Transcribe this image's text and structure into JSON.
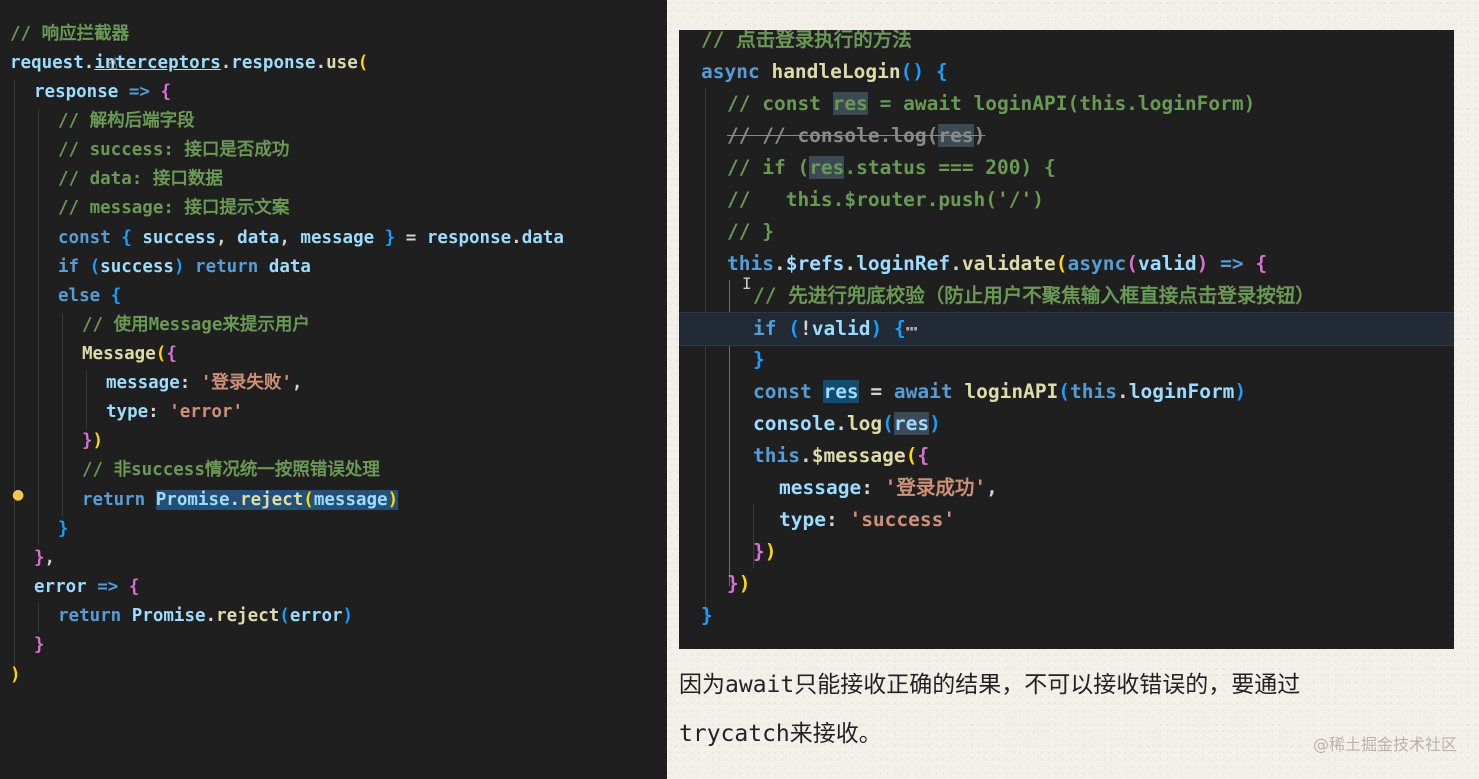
{
  "left_editor": {
    "code": {
      "line_01": [
        "// 响应拦截器"
      ],
      "line_02": [
        "request",
        ".",
        "interceptors",
        ".",
        "response",
        ".",
        "use",
        "("
      ],
      "line_03": [
        "response",
        " ",
        "=>",
        " ",
        "{"
      ],
      "line_04": [
        "// 解构后端字段"
      ],
      "line_05": [
        "// success: 接口是否成功"
      ],
      "line_06": [
        "// data: 接口数据"
      ],
      "line_07": [
        "// message: 接口提示文案"
      ],
      "line_08": [
        "const",
        " ",
        "{",
        " ",
        "success",
        ", ",
        "data",
        ", ",
        "message",
        " ",
        "}",
        " = ",
        "response",
        ".",
        "data"
      ],
      "line_09": [
        "if",
        " ",
        "(",
        "success",
        ")",
        " ",
        "return",
        " ",
        "data"
      ],
      "line_10": [
        "else",
        " ",
        "{"
      ],
      "line_11": [
        "// 使用Message来提示用户"
      ],
      "line_12": [
        "Message",
        "(",
        "{"
      ],
      "line_13": [
        "message",
        ": ",
        "'登录失败'",
        ","
      ],
      "line_14": [
        "type",
        ": ",
        "'error'"
      ],
      "line_15": [
        "}",
        ")"
      ],
      "line_16": [
        "// 非success情况统一按照错误处理"
      ],
      "line_17": [
        "return",
        " ",
        "Promise",
        ".",
        "reject",
        "(",
        "message",
        ")"
      ],
      "line_18": [
        "}"
      ],
      "line_19": [
        "}",
        ","
      ],
      "line_20": [
        "error",
        " ",
        "=>",
        " ",
        "{"
      ],
      "line_21": [
        "return",
        " ",
        "Promise",
        ".",
        "reject",
        "(",
        "error",
        ")"
      ],
      "line_22": [
        "}"
      ],
      "line_23": [
        ")"
      ]
    },
    "gutter_icon": "lightbulb-icon",
    "mouse_icon": "hand-pointer-icon"
  },
  "right_editor": {
    "code": {
      "line_01": [
        "// 点击登录执行的方法"
      ],
      "line_02": [
        "async",
        " ",
        "handleLogin",
        "(",
        ")",
        " ",
        "{"
      ],
      "line_03": [
        "// const ",
        "res",
        " = await loginAPI(this.loginForm)"
      ],
      "line_04": [
        "// // console.log(",
        "res",
        ")"
      ],
      "line_05": [
        "// if (",
        "res",
        ".status === 200) {"
      ],
      "line_06": [
        "//   this.$router.push('/')"
      ],
      "line_07": [
        "// }"
      ],
      "line_08": [
        "this",
        ".",
        "$refs",
        ".",
        "loginRef",
        ".",
        "validate",
        "(",
        "async",
        "(",
        "valid",
        ")",
        " ",
        "=>",
        " ",
        "{"
      ],
      "line_09": [
        "// 先进行兜底校验（防止用户不聚焦输入框直接点击登录按钮）"
      ],
      "line_10": [
        "if",
        " ",
        "(",
        "!",
        "valid",
        ")",
        " ",
        "{",
        "⋯"
      ],
      "line_11": [
        "}"
      ],
      "line_12": [
        "const",
        " ",
        "res",
        " = ",
        "await",
        " ",
        "loginAPI",
        "(",
        "this",
        ".",
        "loginForm",
        ")"
      ],
      "line_13": [
        "console",
        ".",
        "log",
        "(",
        "res",
        ")"
      ],
      "line_14": [
        "this",
        ".",
        "$message",
        "(",
        "{"
      ],
      "line_15": [
        "message",
        ": ",
        "'登录成功'",
        ","
      ],
      "line_16": [
        "type",
        ": ",
        "'success'"
      ],
      "line_17": [
        "}",
        ")"
      ],
      "line_18": [
        "}",
        ")"
      ],
      "line_19": [
        "}"
      ]
    },
    "cursor_icon": "text-cursor-icon"
  },
  "caption": {
    "line1": "因为await只能接收正确的结果，不可以接收错误的，要通过",
    "line2": "trycatch来接收。"
  },
  "watermark": "@稀土掘金技术社区",
  "colors": {
    "editor_bg": "#1f1f1f",
    "page_bg": "#f3f0ea",
    "keyword": "#569cd6",
    "comment": "#6a9955",
    "function": "#dcdcaa",
    "variable": "#9cdcfe",
    "string": "#ce9178",
    "selection": "#264f78"
  }
}
